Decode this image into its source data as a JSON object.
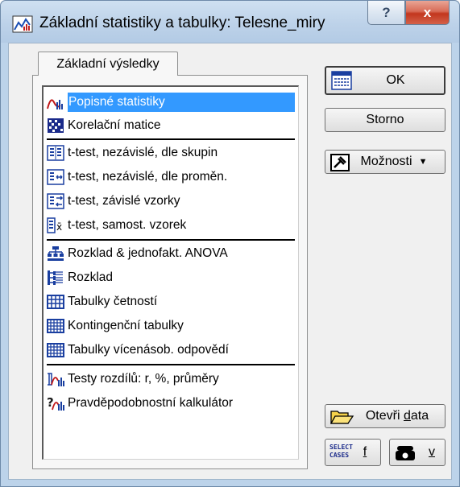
{
  "window": {
    "title": "Základní statistiky a tabulky: Telesne_miry",
    "help_symbol": "?",
    "close_symbol": "x"
  },
  "tab": {
    "label": "Základní výsledky"
  },
  "list": {
    "items": [
      {
        "label": "Popisné statistiky",
        "icon": "descriptive-stats-icon"
      },
      {
        "label": "Korelační matice",
        "icon": "correlation-matrix-icon"
      },
      {
        "label": "t-test, nezávislé, dle skupin",
        "icon": "ttest-groups-icon"
      },
      {
        "label": "t-test, nezávislé, dle proměn.",
        "icon": "ttest-variables-icon"
      },
      {
        "label": "t-test, závislé vzorky",
        "icon": "ttest-dependent-icon"
      },
      {
        "label": "t-test, samost. vzorek",
        "icon": "ttest-single-icon"
      },
      {
        "label": "Rozklad & jednofakt. ANOVA",
        "icon": "breakdown-anova-icon"
      },
      {
        "label": "Rozklad",
        "icon": "breakdown-icon"
      },
      {
        "label": "Tabulky četností",
        "icon": "frequency-tables-icon"
      },
      {
        "label": "Kontingenční tabulky",
        "icon": "contingency-tables-icon"
      },
      {
        "label": "Tabulky vícenásob. odpovědí",
        "icon": "multiple-response-icon"
      },
      {
        "label": "Testy rozdílů: r, %, průměry",
        "icon": "difference-tests-icon"
      },
      {
        "label": "Pravděpodobnostní kalkulátor",
        "icon": "probability-calculator-icon"
      }
    ]
  },
  "buttons": {
    "ok": "OK",
    "cancel": "Storno",
    "options": "Možnosti",
    "open_data_pre": "Otevři ",
    "open_data_mn": "d",
    "open_data_post": "ata",
    "select_cases_icon_text_1": "SELECT",
    "select_cases_icon_text_2": "CASES",
    "select_cases_label": "f",
    "weight_label": "v"
  },
  "colors": {
    "selection": "#3399ff",
    "title_bar": "#bcd3ea",
    "client": "#f0f0f0"
  }
}
